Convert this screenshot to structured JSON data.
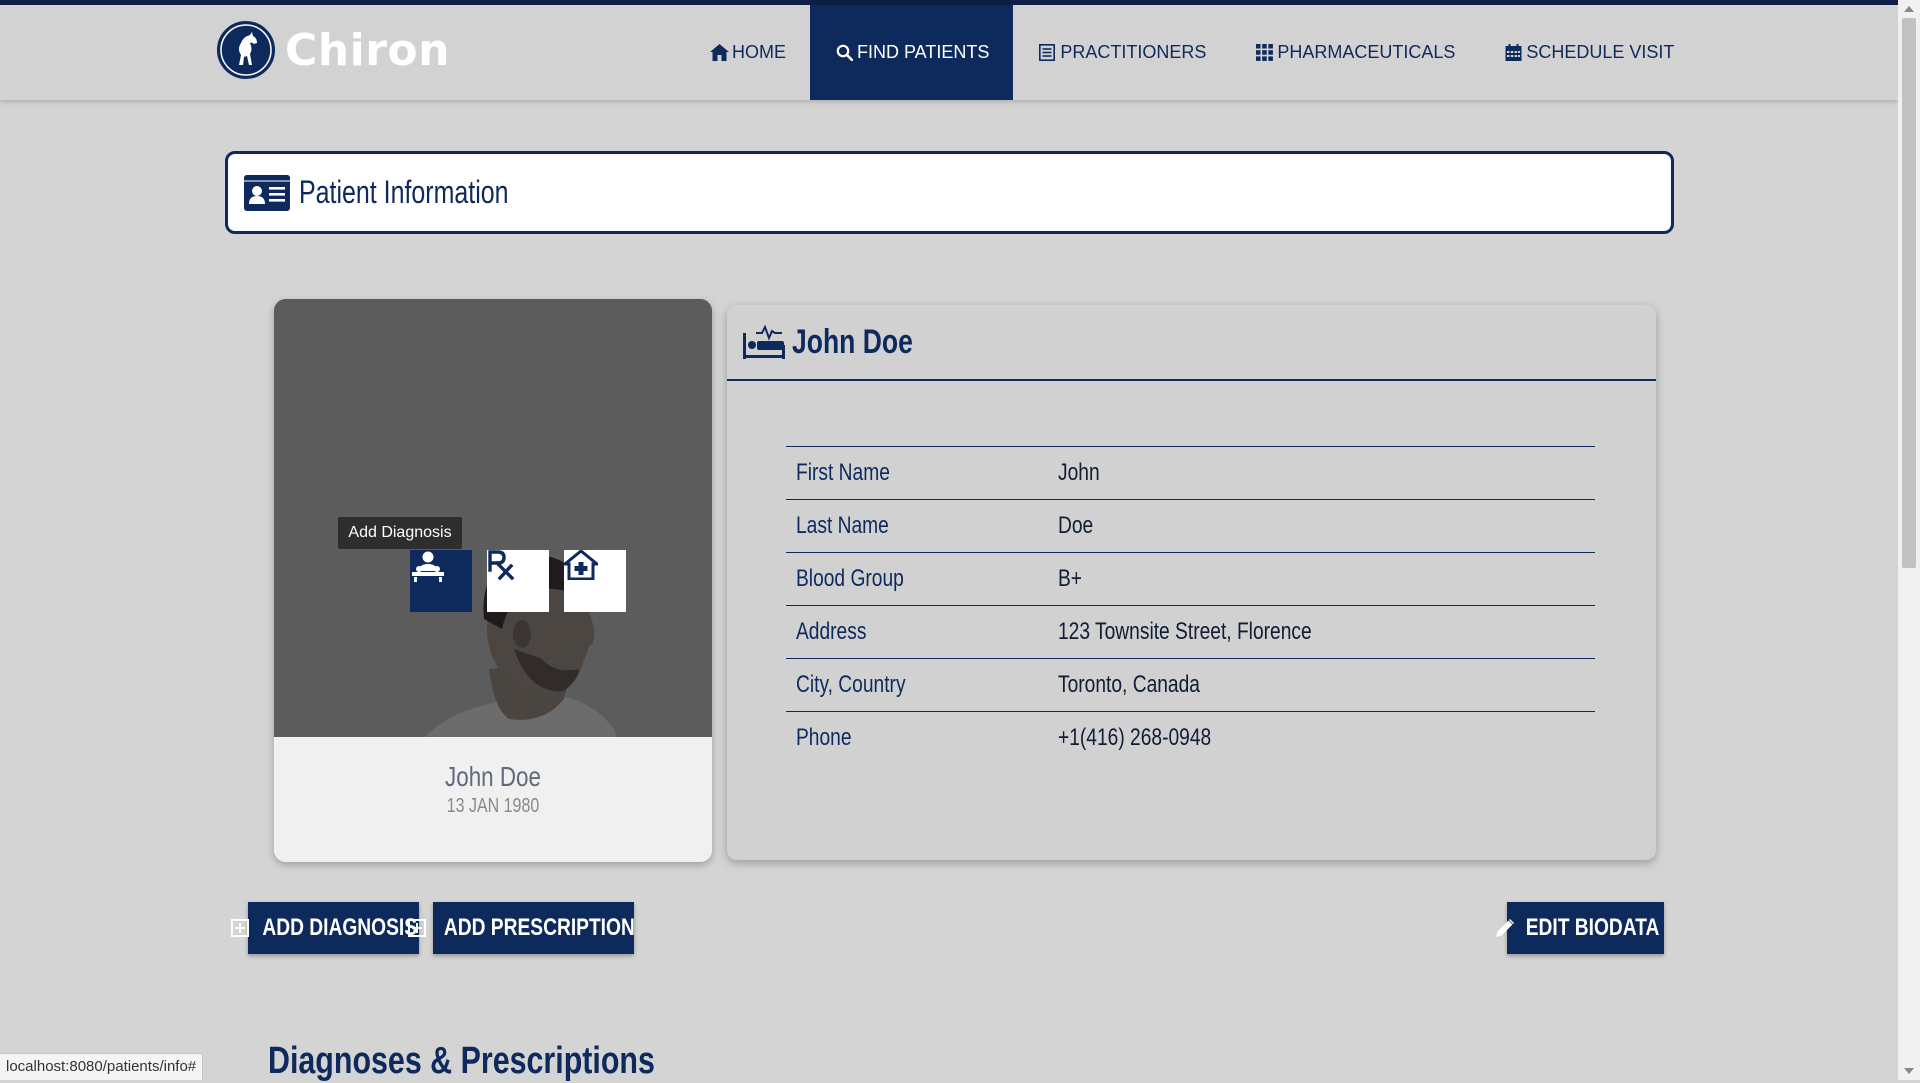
{
  "brand": {
    "name": "Chiron"
  },
  "nav": {
    "items": [
      {
        "label": "HOME",
        "icon": "home-icon"
      },
      {
        "label": "FIND PATIENTS",
        "icon": "search-icon",
        "active": true
      },
      {
        "label": "PRACTITIONERS",
        "icon": "list-icon"
      },
      {
        "label": "PHARMACEUTICALS",
        "icon": "grid-icon"
      },
      {
        "label": "SCHEDULE VISIT",
        "icon": "calendar-icon"
      }
    ]
  },
  "header": {
    "title": "Patient Information",
    "icon": "id-card-icon"
  },
  "photo_card": {
    "name": "John Doe",
    "dob": "13 JAN 1980",
    "tooltip": "Add Diagnosis",
    "actions": [
      {
        "icon": "diagnosis-icon"
      },
      {
        "icon": "prescription-icon"
      },
      {
        "icon": "home-plus-icon"
      }
    ]
  },
  "info_card": {
    "title": "John Doe",
    "icon": "patient-bed-icon",
    "rows": [
      {
        "label": "First Name",
        "value": "John"
      },
      {
        "label": "Last Name",
        "value": "Doe"
      },
      {
        "label": "Blood Group",
        "value": "B+"
      },
      {
        "label": "Address",
        "value": "123 Townsite Street, Florence"
      },
      {
        "label": "City, Country",
        "value": "Toronto, Canada"
      },
      {
        "label": "Phone",
        "value": "+1(416) 268-0948"
      }
    ]
  },
  "buttons": {
    "add_diagnosis": "ADD DIAGNOSIS",
    "add_prescription": "ADD PRESCRIPTION",
    "edit_biodata": "EDIT BIODATA"
  },
  "section": {
    "title": "Diagnoses & Prescriptions"
  },
  "status_bar": {
    "url": "localhost:8080/patients/info#"
  },
  "colors": {
    "primary": "#0e2a5c",
    "background": "#d4d4d4",
    "card": "#ffffff"
  }
}
